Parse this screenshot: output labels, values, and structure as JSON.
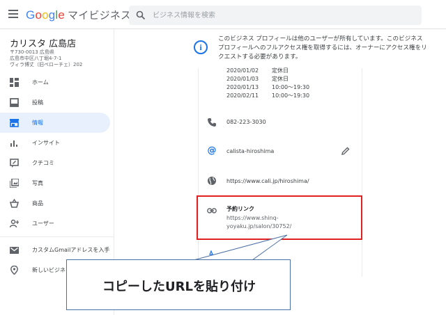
{
  "header": {
    "brand_google": "Google",
    "brand_product": "マイビジネス",
    "search_placeholder": "ビジネス情報を検索"
  },
  "business": {
    "name": "カリスタ 広島店",
    "address_lines": [
      "〒730-0013 広島県",
      "広島市中区八丁堀4-7-1",
      "ヴィラ博丈（旧ペローチェ）202"
    ]
  },
  "sidebar": {
    "items": [
      {
        "label": "ホーム",
        "icon": "dashboard-icon"
      },
      {
        "label": "投稿",
        "icon": "posts-icon"
      },
      {
        "label": "情報",
        "icon": "storefront-icon",
        "active": true
      },
      {
        "label": "インサイト",
        "icon": "insights-icon"
      },
      {
        "label": "クチコミ",
        "icon": "reviews-icon"
      },
      {
        "label": "写真",
        "icon": "photos-icon"
      },
      {
        "label": "商品",
        "icon": "products-icon"
      },
      {
        "label": "ユーザー",
        "icon": "add-user-icon"
      }
    ],
    "extra": [
      {
        "label": "カスタムGmailアドレスを入手",
        "icon": "gmail-icon"
      },
      {
        "label": "新しいビジネ",
        "icon": "location-pin-icon"
      }
    ]
  },
  "notice": {
    "text": "このビジネス プロフィールは他のユーザーが所有しています。このビジネスプロフィールへのフルアクセス権を取得するには、オーナーにアクセス権をリクエストする必要があります。"
  },
  "special_hours": [
    {
      "date": "2020/01/02",
      "value": "定休日"
    },
    {
      "date": "2020/01/03",
      "value": "定休日"
    },
    {
      "date": "2020/01/13",
      "value": "10:00～19:30"
    },
    {
      "date": "2020/02/11",
      "value": "10:00～19:30"
    }
  ],
  "info": {
    "phone": "082-223-3030",
    "short_name": "calista-hiroshima",
    "website": "https://www.cali.jp/hiroshima/",
    "reservation_title": "予約リンク",
    "reservation_url": "https://www.shinq-yoyaku.jp/salon/30752/"
  },
  "callout": {
    "text": "コピーしたURLを貼り付け"
  },
  "colors": {
    "accent": "#1a73e8",
    "active_bg": "#e8f0fe",
    "highlight": "#e02020",
    "callout_border": "#4a6fa5"
  }
}
